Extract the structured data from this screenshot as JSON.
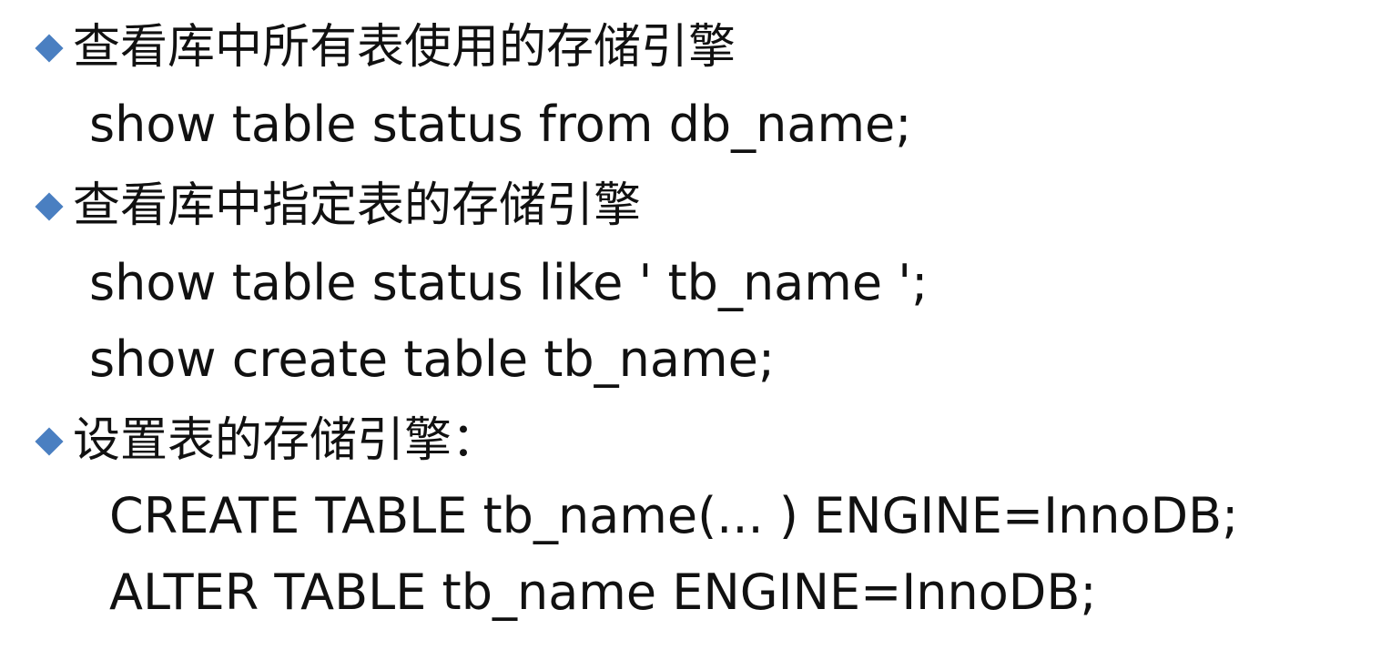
{
  "slide": {
    "items": [
      {
        "heading": "查看库中所有表使用的存储引擎",
        "commands": [
          "show table status from db_name;"
        ]
      },
      {
        "heading": "查看库中指定表的存储引擎",
        "commands": [
          "show table status like ' tb_name ';",
          "show create table tb_name;"
        ]
      },
      {
        "heading": "设置表的存储引擎：",
        "commands": [
          "CREATE TABLE tb_name(... ) ENGINE=InnoDB;",
          "ALTER TABLE tb_name ENGINE=InnoDB;"
        ]
      }
    ],
    "accent_color": "#4a7fc1",
    "bullet_icon": "diamond-bullet-icon"
  }
}
